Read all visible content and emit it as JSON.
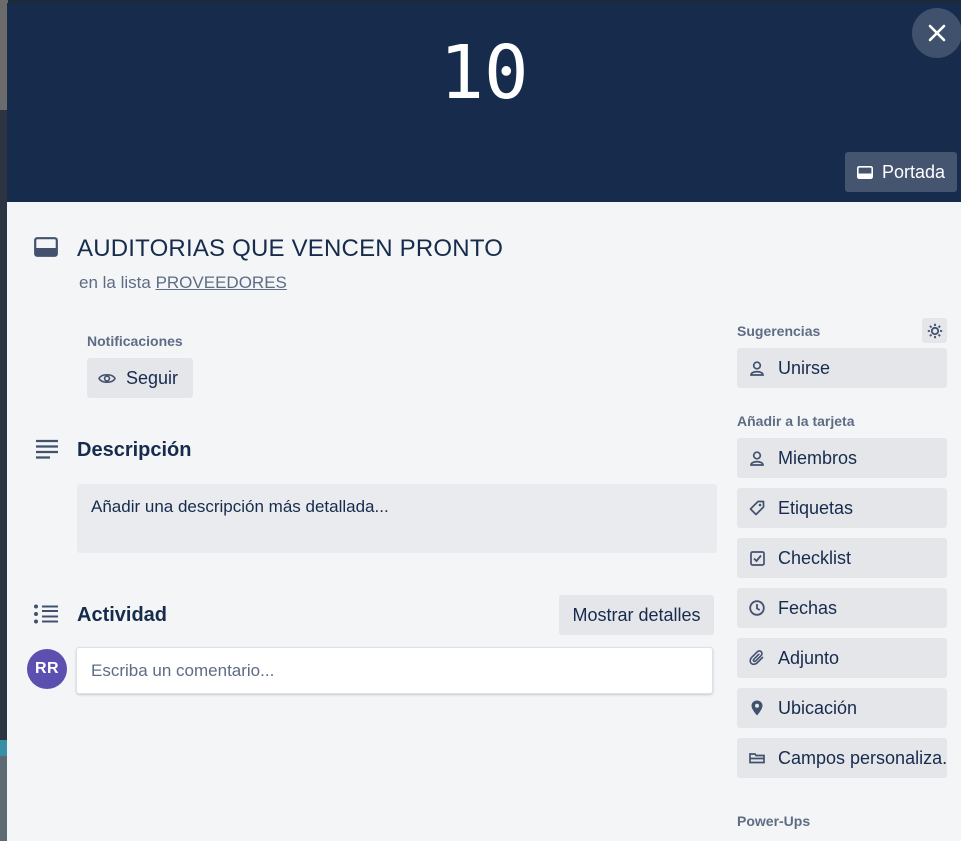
{
  "cover": {
    "text": "10",
    "cover_button": "Portada"
  },
  "card": {
    "title": "AUDITORIAS QUE VENCEN PRONTO",
    "list_prefix": "en la lista",
    "list_name": "PROVEEDORES"
  },
  "notifications": {
    "label": "Notificaciones",
    "follow_button": "Seguir"
  },
  "description": {
    "title": "Descripción",
    "placeholder": "Añadir una descripción más detallada..."
  },
  "activity": {
    "title": "Actividad",
    "details_button": "Mostrar detalles",
    "avatar_initials": "RR",
    "comment_placeholder": "Escriba un comentario..."
  },
  "sidebar": {
    "suggestions_label": "Sugerencias",
    "join_button": "Unirse",
    "add_to_card_label": "Añadir a la tarjeta",
    "items": [
      {
        "label": "Miembros",
        "icon": "person-icon"
      },
      {
        "label": "Etiquetas",
        "icon": "tag-icon"
      },
      {
        "label": "Checklist",
        "icon": "checkbox-icon"
      },
      {
        "label": "Fechas",
        "icon": "clock-icon"
      },
      {
        "label": "Adjunto",
        "icon": "paperclip-icon"
      },
      {
        "label": "Ubicación",
        "icon": "location-pin-icon"
      },
      {
        "label": "Campos personaliza...",
        "icon": "custom-fields-icon"
      }
    ],
    "powerups_label": "Power-Ups"
  },
  "colors": {
    "cover_bg": "#172b4d",
    "modal_bg": "#f4f5f7",
    "button_bg": "#e4e6ea",
    "text": "#172b4d",
    "muted": "#5e6c84",
    "avatar": "#5b4fb0"
  }
}
